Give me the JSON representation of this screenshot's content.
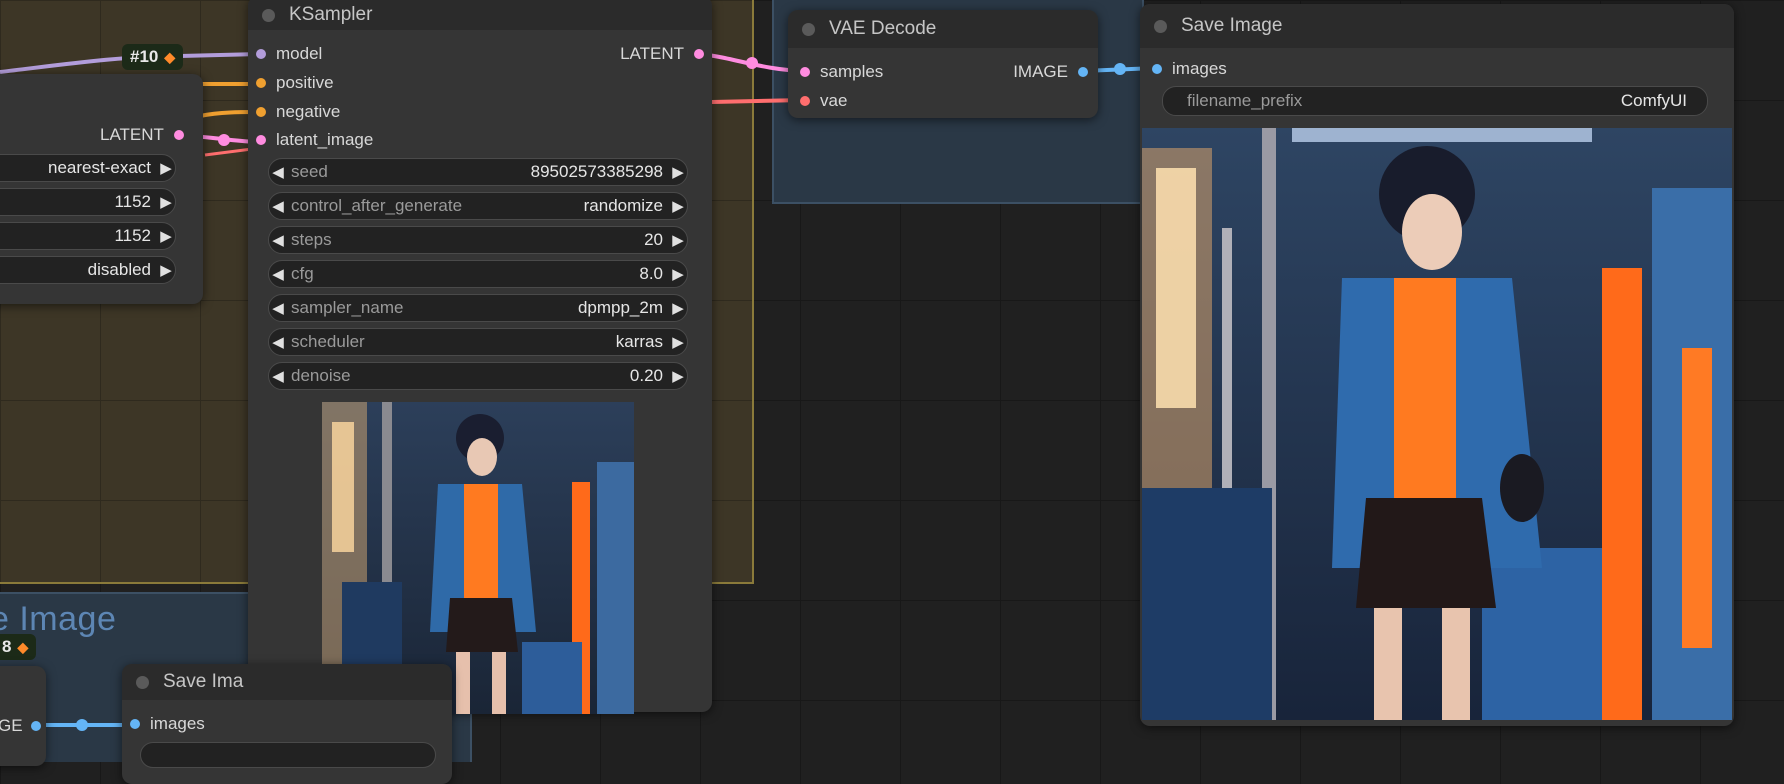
{
  "ksampler": {
    "title": "KSampler",
    "inputs": [
      "model",
      "positive",
      "negative",
      "latent_image"
    ],
    "output": "LATENT",
    "widgets": [
      {
        "label": "seed",
        "value": "89502573385298"
      },
      {
        "label": "control_after_generate",
        "value": "randomize"
      },
      {
        "label": "steps",
        "value": "20"
      },
      {
        "label": "cfg",
        "value": "8.0"
      },
      {
        "label": "sampler_name",
        "value": "dpmpp_2m"
      },
      {
        "label": "scheduler",
        "value": "karras"
      },
      {
        "label": "denoise",
        "value": "0.20"
      }
    ]
  },
  "vae_decode": {
    "title": "VAE Decode",
    "inputs": [
      "samples",
      "vae"
    ],
    "output": "IMAGE"
  },
  "save_image": {
    "title": "Save Image",
    "input": "images",
    "widget": {
      "label": "filename_prefix",
      "value": "ComfyUI"
    }
  },
  "save_image_small": {
    "title": "Save Ima",
    "input": "images"
  },
  "left_node": {
    "output": "LATENT",
    "widgets": [
      "nearest-exact",
      "1152",
      "1152",
      "disabled"
    ],
    "partial_output": "GE"
  },
  "badges": {
    "b1": "#10",
    "b2": "8"
  },
  "group_title": "e Image",
  "colors": {
    "model": "#b39ddb",
    "conditioning": "#f0a030",
    "latent": "#ff8ce0",
    "vae": "#ff6e6e",
    "image": "#64b5f6"
  }
}
